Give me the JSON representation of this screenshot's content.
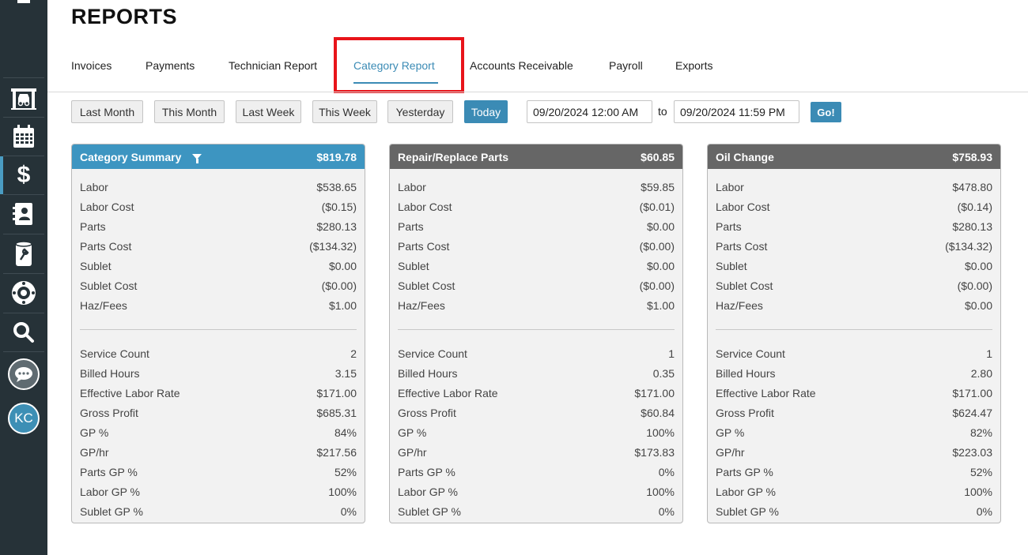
{
  "page": {
    "title": "REPORTS"
  },
  "sidebar": {
    "avatar_initials": "KC"
  },
  "tabs": [
    {
      "label": "Invoices"
    },
    {
      "label": "Payments"
    },
    {
      "label": "Technician Report"
    },
    {
      "label": "Category Report"
    },
    {
      "label": "Accounts Receivable"
    },
    {
      "label": "Payroll"
    },
    {
      "label": "Exports"
    }
  ],
  "filters": {
    "buttons": [
      "Last Month",
      "This Month",
      "Last Week",
      "This Week",
      "Yesterday",
      "Today"
    ],
    "active": "Today",
    "start": "09/20/2024 12:00 AM",
    "to_label": "to",
    "end": "09/20/2024 11:59 PM",
    "go_label": "Go!"
  },
  "cards": [
    {
      "title": "Category Summary",
      "total": "$819.78",
      "top_rows": [
        [
          "Labor",
          "$538.65"
        ],
        [
          "Labor Cost",
          "($0.15)"
        ],
        [
          "Parts",
          "$280.13"
        ],
        [
          "Parts Cost",
          "($134.32)"
        ],
        [
          "Sublet",
          "$0.00"
        ],
        [
          "Sublet Cost",
          "($0.00)"
        ],
        [
          "Haz/Fees",
          "$1.00"
        ]
      ],
      "bottom_rows": [
        [
          "Service Count",
          "2"
        ],
        [
          "Billed Hours",
          "3.15"
        ],
        [
          "Effective Labor Rate",
          "$171.00"
        ],
        [
          "Gross Profit",
          "$685.31"
        ],
        [
          "GP %",
          "84%"
        ],
        [
          "GP/hr",
          "$217.56"
        ],
        [
          "Parts GP %",
          "52%"
        ],
        [
          "Labor GP %",
          "100%"
        ],
        [
          "Sublet GP %",
          "0%"
        ]
      ]
    },
    {
      "title": "Repair/Replace Parts",
      "total": "$60.85",
      "top_rows": [
        [
          "Labor",
          "$59.85"
        ],
        [
          "Labor Cost",
          "($0.01)"
        ],
        [
          "Parts",
          "$0.00"
        ],
        [
          "Parts Cost",
          "($0.00)"
        ],
        [
          "Sublet",
          "$0.00"
        ],
        [
          "Sublet Cost",
          "($0.00)"
        ],
        [
          "Haz/Fees",
          "$1.00"
        ]
      ],
      "bottom_rows": [
        [
          "Service Count",
          "1"
        ],
        [
          "Billed Hours",
          "0.35"
        ],
        [
          "Effective Labor Rate",
          "$171.00"
        ],
        [
          "Gross Profit",
          "$60.84"
        ],
        [
          "GP %",
          "100%"
        ],
        [
          "GP/hr",
          "$173.83"
        ],
        [
          "Parts GP %",
          "0%"
        ],
        [
          "Labor GP %",
          "100%"
        ],
        [
          "Sublet GP %",
          "0%"
        ]
      ]
    },
    {
      "title": "Oil Change",
      "total": "$758.93",
      "top_rows": [
        [
          "Labor",
          "$478.80"
        ],
        [
          "Labor Cost",
          "($0.14)"
        ],
        [
          "Parts",
          "$280.13"
        ],
        [
          "Parts Cost",
          "($134.32)"
        ],
        [
          "Sublet",
          "$0.00"
        ],
        [
          "Sublet Cost",
          "($0.00)"
        ],
        [
          "Haz/Fees",
          "$0.00"
        ]
      ],
      "bottom_rows": [
        [
          "Service Count",
          "1"
        ],
        [
          "Billed Hours",
          "2.80"
        ],
        [
          "Effective Labor Rate",
          "$171.00"
        ],
        [
          "Gross Profit",
          "$624.47"
        ],
        [
          "GP %",
          "82%"
        ],
        [
          "GP/hr",
          "$223.03"
        ],
        [
          "Parts GP %",
          "52%"
        ],
        [
          "Labor GP %",
          "100%"
        ],
        [
          "Sublet GP %",
          "0%"
        ]
      ]
    }
  ],
  "colors": {
    "accent": "#3b8bb5",
    "sidebar": "#263238",
    "highlight": "#e8141a",
    "card_gray_header": "#666666"
  }
}
